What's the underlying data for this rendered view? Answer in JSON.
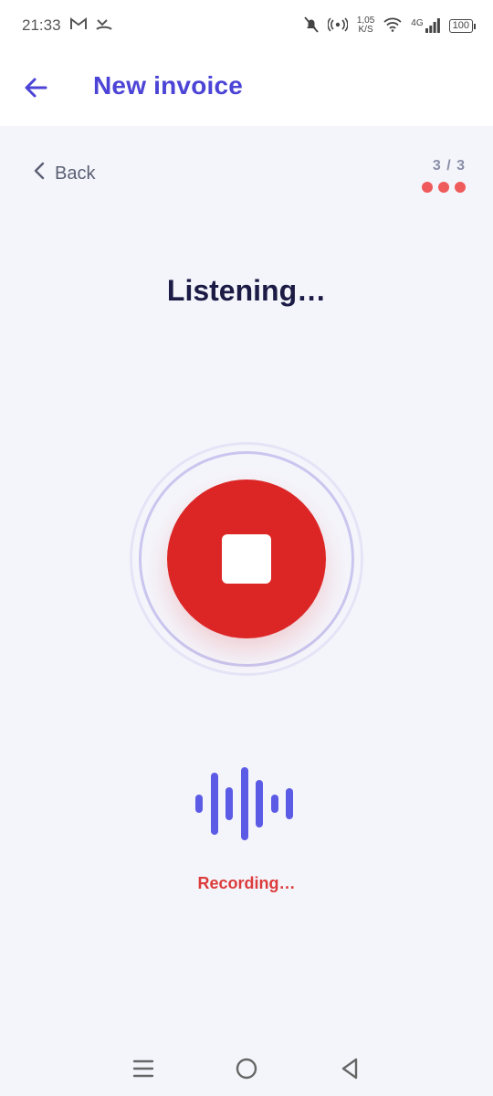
{
  "status_bar": {
    "time": "21:33",
    "net_speed_value": "1,05",
    "net_speed_unit": "K/S",
    "network": "4G",
    "battery": "100"
  },
  "header": {
    "title": "New invoice"
  },
  "step_nav": {
    "back_label": "Back",
    "step_count": "3 / 3",
    "dots": 3
  },
  "main": {
    "heading": "Listening…",
    "status": "Recording…"
  },
  "colors": {
    "accent": "#4c44d6",
    "record_red": "#dc2626",
    "waveform": "#5b5be6",
    "status_text": "#dc3b3b"
  },
  "waveform": {
    "levels": [
      0.25,
      0.85,
      0.45,
      1.0,
      0.65,
      0.25,
      0.42
    ]
  }
}
